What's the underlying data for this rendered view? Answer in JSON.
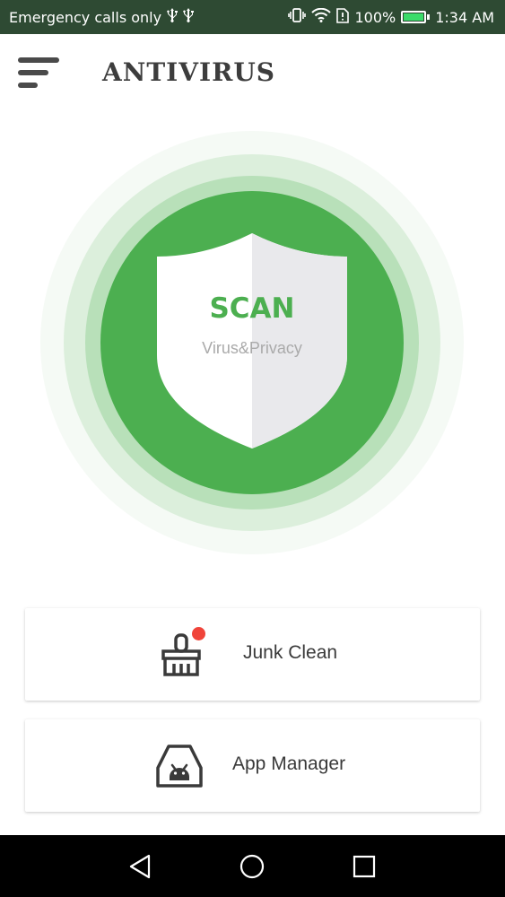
{
  "status_bar": {
    "carrier_text": "Emergency calls only",
    "battery_percent": "100%",
    "time": "1:34 AM",
    "icons": [
      "usb-icon",
      "usb-icon",
      "vibrate-icon",
      "wifi-icon",
      "sim-alert-icon",
      "battery-icon"
    ]
  },
  "header": {
    "title": "ANTIVIRUS",
    "menu_icon": "hamburger-menu-icon"
  },
  "scan": {
    "label": "SCAN",
    "sublabel": "Virus&Privacy",
    "icon": "shield-icon"
  },
  "features": [
    {
      "label": "Junk Clean",
      "icon": "broom-icon",
      "has_notification": true
    },
    {
      "label": "App Manager",
      "icon": "android-box-icon",
      "has_notification": false
    }
  ],
  "nav": {
    "icons": [
      "back-triangle-icon",
      "home-circle-icon",
      "recents-square-icon"
    ]
  },
  "colors": {
    "accent": "#4caf50",
    "status_bar_bg": "#2e4a33",
    "notification_dot": "#f0443a",
    "nav_bar_bg": "#000000"
  }
}
